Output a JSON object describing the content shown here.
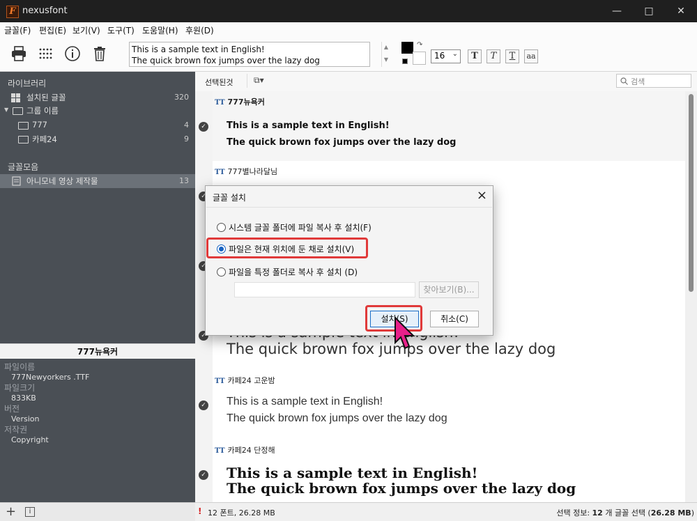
{
  "window": {
    "title": "nexusfont",
    "app_icon_letter": "F"
  },
  "menu": [
    "글꼴(F)",
    "편집(E)",
    "보기(V)",
    "도구(T)",
    "도움말(H)",
    "후원(D)"
  ],
  "toolbar": {
    "sample_line1": "This is a sample text in English!",
    "sample_line2": "The quick brown fox jumps over the lazy dog",
    "font_size": "16",
    "format_buttons": [
      "T",
      "T",
      "T",
      "aa"
    ]
  },
  "sidebar": {
    "library_label": "라이브러리",
    "installed_label": "설치된 글꼴",
    "installed_count": "320",
    "group_label": "그룹 이름",
    "groups": [
      {
        "label": "777",
        "count": "4"
      },
      {
        "label": "카페24",
        "count": "9"
      }
    ],
    "collection_label": "글꼴모음",
    "collection_item": "아니모네 영상 제작물",
    "collection_count": "13"
  },
  "font_info": {
    "header": "777뉴욕커",
    "filename_label": "파일이름",
    "filename": "777Newyorkers .TTF",
    "filesize_label": "파일크기",
    "filesize": "833KB",
    "version_label": "버전",
    "version": "Version",
    "copyright_label": "저작권",
    "copyright": "Copyright"
  },
  "main_toolbar": {
    "selected_label": "선택된것",
    "search_placeholder": "검색"
  },
  "fonts": [
    {
      "name": "777뉴욕커",
      "line1": "This is a sample text in English!",
      "line2": "The quick brown fox jumps over the lazy dog"
    },
    {
      "name": "777별나라달님",
      "line1": "",
      "line2": ""
    },
    {
      "name": "",
      "line1": "",
      "line2": ""
    },
    {
      "name": "",
      "line1": "This is a sample text in English!",
      "line2": "The quick brown fox jumps over the lazy dog"
    },
    {
      "name": "카페24 고운밤",
      "line1": "This is a sample text in English!",
      "line2": "The quick brown fox jumps over the lazy dog"
    },
    {
      "name": "카페24 단정해",
      "line1": "This is a sample text in English!",
      "line2": "The quick brown fox jumps over the lazy dog"
    }
  ],
  "status": {
    "fonts_info": "12 폰트, 26.28 MB",
    "selection_prefix": "선택 정보: ",
    "selection_count": "12",
    "selection_mid": " 개 글꼴 선택 (",
    "selection_size": "26.28 MB",
    "selection_suffix": ")"
  },
  "dialog": {
    "title": "글꼴 설치",
    "option1": "시스템 글꼴 폴더에 파일 복사 후 설치(F)",
    "option2": "파일은 현재 위치에 둔 채로 설치(V)",
    "option3": "파일을 특정 폴더로 복사 후 설치 (D)",
    "path_value": "",
    "browse": "찾아보기(B)...",
    "install": "설치(S)",
    "cancel": "취소(C)"
  },
  "colors": {
    "highlight": "#e03a3a",
    "accent": "#1562c2",
    "cursor": "#e8208a"
  }
}
